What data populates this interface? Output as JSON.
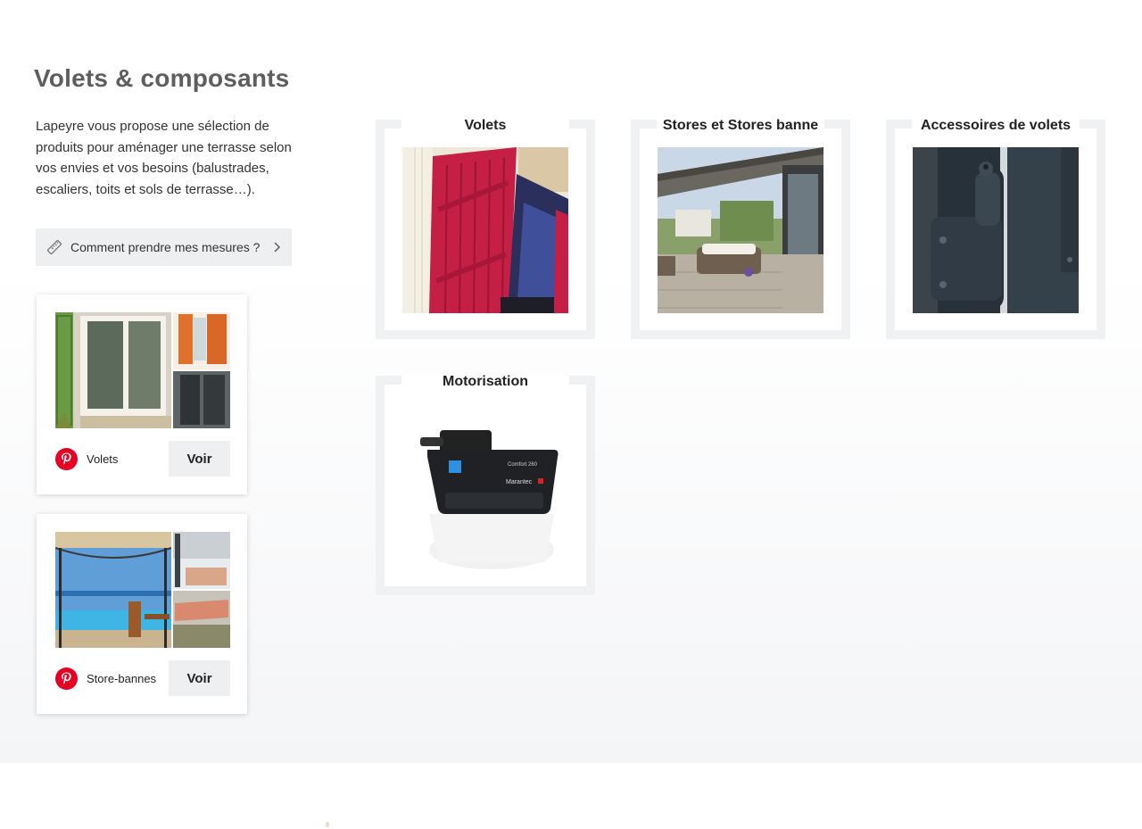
{
  "section": {
    "title": "Volets & composants",
    "intro": "Lapeyre vous propose une sélection de produits pour aménager une terrasse selon vos envies et vos besoins (balustrades, escaliers, toits et sols de terrasse…).",
    "measure_button": "Comment prendre mes mesures ?"
  },
  "pinterest_cards": [
    {
      "label": "Volets",
      "button": "Voir"
    },
    {
      "label": "Store-bannes",
      "button": "Voir"
    }
  ],
  "categories": [
    {
      "title": "Volets"
    },
    {
      "title": "Stores et Stores banne"
    },
    {
      "title": "Accessoires de volets"
    },
    {
      "title": "Motorisation"
    }
  ],
  "colors": {
    "pinterest_red": "#e60023",
    "title_grey": "#5e5e5e",
    "button_bg": "#eeeff1",
    "frame_grey": "#f0f1f3"
  },
  "icons": [
    "ruler-icon",
    "chevron-right-icon",
    "pinterest-icon"
  ]
}
